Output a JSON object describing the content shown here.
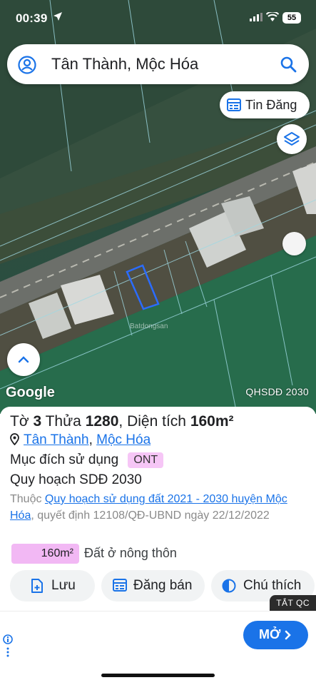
{
  "status": {
    "time": "00:39",
    "battery": "55"
  },
  "search": {
    "query": "Tân Thành, Mộc Hóa"
  },
  "map": {
    "tin_dang_label": "Tin Đăng",
    "google_label": "Google",
    "layer_tag": "QHSDĐ 2030",
    "watermark": "Batdongsan"
  },
  "parcel": {
    "to_label": "Tờ",
    "to_value": "3",
    "thua_label": "Thửa",
    "thua_value": "1280",
    "area_label": ", Diện tích",
    "area_value": "160m²",
    "commune": "Tân Thành",
    "district": "Mộc Hóa",
    "purpose_label": "Mục đích sử dụng",
    "purpose_code": "ONT",
    "plan_title": "Quy hoạch SDĐ 2030",
    "desc_prefix": "Thuộc ",
    "plan_link": "Quy hoạch sử dụng đất 2021 - 2030 huyện Mộc Hóa",
    "desc_suffix": ", quyết định 12108/QĐ-UBND ngày 22/12/2022",
    "legend_area": "160m²",
    "legend_text": "Đất ở nông thôn",
    "legend_color": "#f2b8f4"
  },
  "actions": {
    "save": "Lưu",
    "sell": "Đăng bán",
    "note": "Chú thích"
  },
  "ad": {
    "hide_label": "TẮT QC",
    "more_label": "MỞ"
  },
  "colors": {
    "accent": "#1a73e8",
    "badge": "#f6c6f6"
  }
}
